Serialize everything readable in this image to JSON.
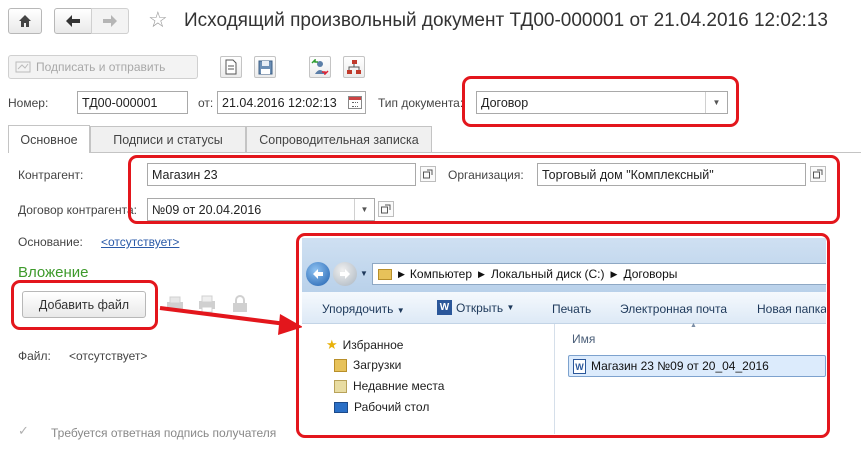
{
  "title": "Исходящий произвольный документ ТД00-000001 от 21.04.2016 12:02:13",
  "toolbar": {
    "sign_send": "Подписать и отправить"
  },
  "header": {
    "number_label": "Номер:",
    "number_value": "ТД00-000001",
    "date_label": "от:",
    "date_value": "21.04.2016 12:02:13",
    "doctype_label": "Тип документа:",
    "doctype_value": "Договор"
  },
  "tabs": [
    {
      "label": "Основное"
    },
    {
      "label": "Подписи и статусы"
    },
    {
      "label": "Сопроводительная записка"
    }
  ],
  "main": {
    "counterparty_label": "Контрагент:",
    "counterparty_value": "Магазин 23",
    "organization_label": "Организация:",
    "organization_value": "Торговый дом \"Комплексный\"",
    "contract_label": "Договор контрагента:",
    "contract_value": "№09 от 20.04.2016",
    "basis_label": "Основание:",
    "basis_value": "<отсутствует>",
    "attachment_title": "Вложение",
    "add_file": "Добавить файл",
    "file_label": "Файл:",
    "file_value": "<отсутствует>",
    "reply_sign": "Требуется ответная подпись получателя"
  },
  "explorer": {
    "breadcrumb": [
      "Компьютер",
      "Локальный диск (C:)",
      "Договоры"
    ],
    "commands": [
      "Упорядочить",
      "Открыть",
      "Печать",
      "Электронная почта",
      "Новая папка"
    ],
    "col_name": "Имя",
    "favorites": "Избранное",
    "nav": [
      "Загрузки",
      "Недавние места",
      "Рабочий стол"
    ],
    "file": "Магазин 23 №09 от 20_04_2016"
  },
  "colors": {
    "accent_red": "#e3161c",
    "green_title": "#3d9a2b",
    "link": "#2a5aa8"
  }
}
